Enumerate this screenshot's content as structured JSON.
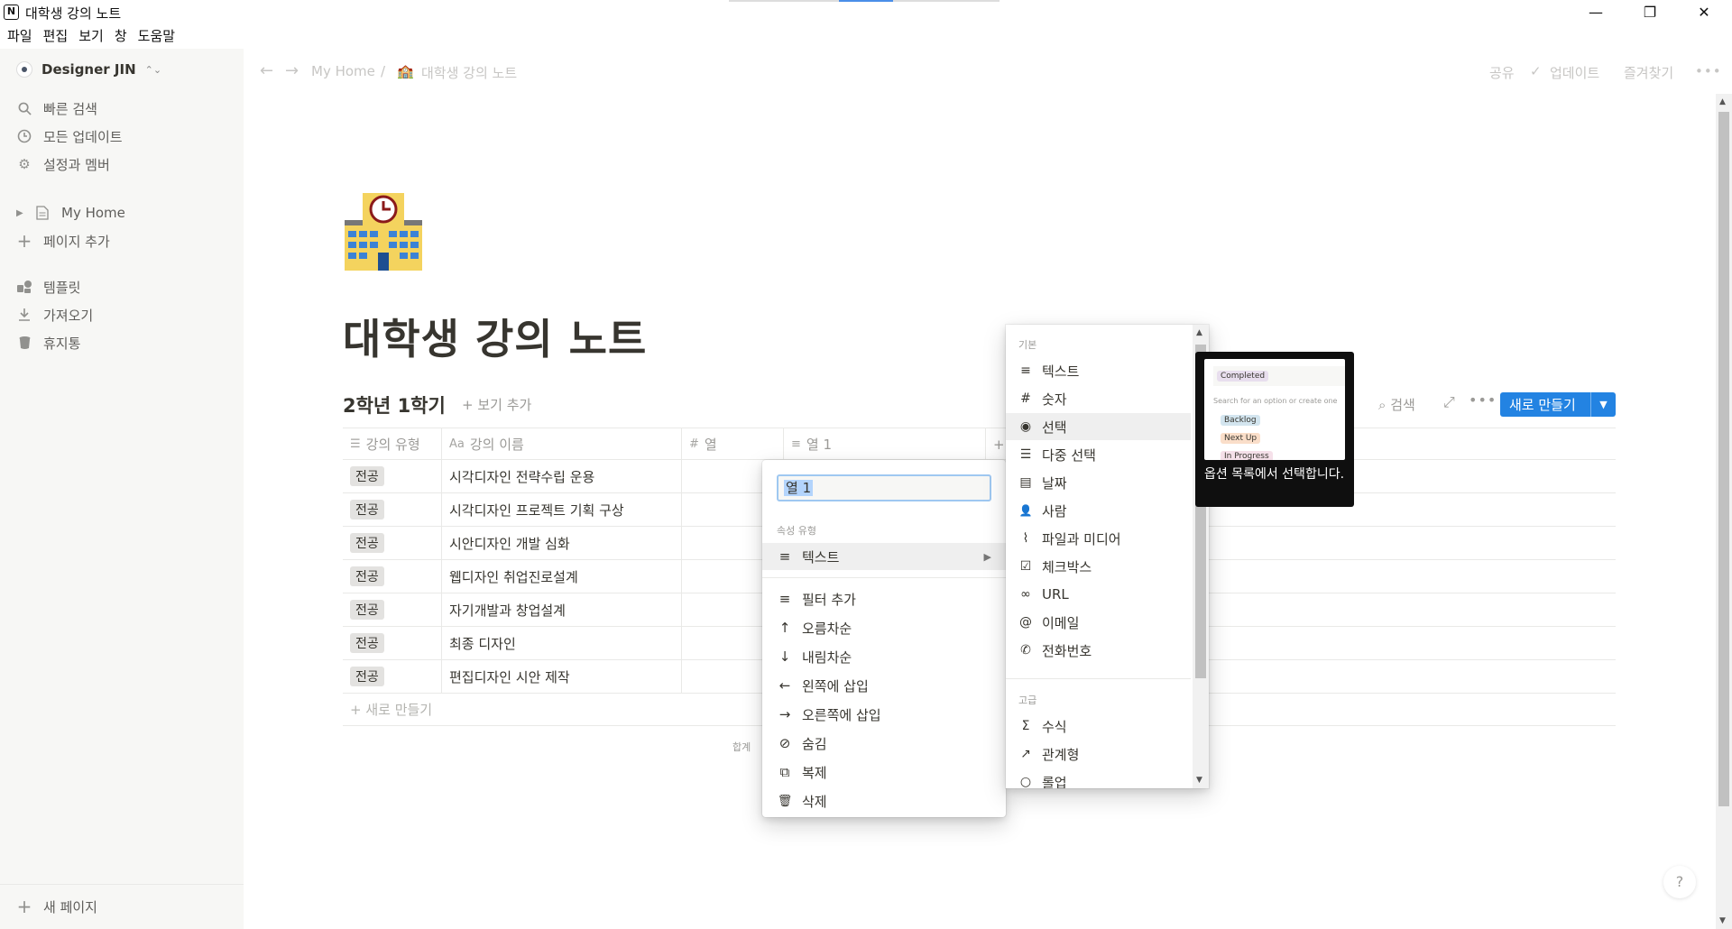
{
  "window": {
    "title": "대학생 강의 노트",
    "logo_letter": "N",
    "minimize": "—",
    "maximize": "❐",
    "close": "✕"
  },
  "menubar": [
    "파일",
    "편집",
    "보기",
    "창",
    "도움말"
  ],
  "sidebar": {
    "workspace": "Designer JIN",
    "items": [
      {
        "label": "빠른 검색",
        "icon": "search-icon"
      },
      {
        "label": "모든 업데이트",
        "icon": "clock-icon"
      },
      {
        "label": "설정과 멤버",
        "icon": "gear-icon"
      }
    ],
    "pages": [
      {
        "label": "My Home",
        "icon": "page-icon"
      },
      {
        "label": "페이지 추가",
        "icon": "plus-icon"
      }
    ],
    "tools": [
      {
        "label": "템플릿",
        "icon": "template-icon"
      },
      {
        "label": "가져오기",
        "icon": "download-icon"
      },
      {
        "label": "휴지통",
        "icon": "trash-icon"
      }
    ],
    "new_page": "새 페이지"
  },
  "topbar": {
    "breadcrumb": [
      "My Home",
      "대학생 강의 노트"
    ],
    "share": "공유",
    "updates": "업데이트",
    "favorite": "즐겨찾기",
    "more": "•••"
  },
  "page": {
    "title": "대학생 강의 노트",
    "view_title": "2학년 1학기",
    "add_view": "+ 보기 추가",
    "search": "검색",
    "more": "•••",
    "new_button": "새로 만들기"
  },
  "table": {
    "headers": [
      {
        "label": "강의 유형",
        "icon": "☰"
      },
      {
        "label": "강의 이름",
        "icon": "Aa"
      },
      {
        "label": "열",
        "icon": "#"
      },
      {
        "label": "열 1",
        "icon": "≡"
      },
      {
        "label": "+",
        "icon": ""
      }
    ],
    "rows": [
      {
        "type": "전공",
        "name": "시각디자인 전략수립 운용"
      },
      {
        "type": "전공",
        "name": "시각디자인 프로젝트 기획 구상"
      },
      {
        "type": "전공",
        "name": "시안디자인 개발 심화"
      },
      {
        "type": "전공",
        "name": "웹디자인 취업진로설계"
      },
      {
        "type": "전공",
        "name": "자기개발과 창업설계"
      },
      {
        "type": "전공",
        "name": "최종 디자인"
      },
      {
        "type": "전공",
        "name": "편집디자인 시안 제작"
      }
    ],
    "new_row": "+ 새로 만들기",
    "count_label": "합계"
  },
  "context_menu": {
    "input_value": "열 1",
    "section_label": "속성 유형",
    "type_item": "텍스트",
    "items": [
      {
        "label": "필터 추가",
        "icon": "filter-icon",
        "glyph": "≡"
      },
      {
        "label": "오름차순",
        "icon": "arrow-up-icon",
        "glyph": "↑"
      },
      {
        "label": "내림차순",
        "icon": "arrow-down-icon",
        "glyph": "↓"
      },
      {
        "label": "왼쪽에 삽입",
        "icon": "arrow-left-icon",
        "glyph": "←"
      },
      {
        "label": "오른쪽에 삽입",
        "icon": "arrow-right-icon",
        "glyph": "→"
      },
      {
        "label": "숨김",
        "icon": "eye-off-icon",
        "glyph": "⊘"
      },
      {
        "label": "복제",
        "icon": "duplicate-icon",
        "glyph": "⧉"
      },
      {
        "label": "삭제",
        "icon": "trash-icon",
        "glyph": "🗑"
      }
    ]
  },
  "type_menu": {
    "basic_label": "기본",
    "advanced_label": "고급",
    "basic": [
      {
        "label": "텍스트",
        "icon": "text-icon",
        "glyph": "≡"
      },
      {
        "label": "숫자",
        "icon": "number-icon",
        "glyph": "#"
      },
      {
        "label": "선택",
        "icon": "select-icon",
        "glyph": "◉"
      },
      {
        "label": "다중 선택",
        "icon": "multi-select-icon",
        "glyph": "☰"
      },
      {
        "label": "날짜",
        "icon": "calendar-icon",
        "glyph": "▤"
      },
      {
        "label": "사람",
        "icon": "person-icon",
        "glyph": "👤"
      },
      {
        "label": "파일과 미디어",
        "icon": "attachment-icon",
        "glyph": "⌇"
      },
      {
        "label": "체크박스",
        "icon": "checkbox-icon",
        "glyph": "☑"
      },
      {
        "label": "URL",
        "icon": "link-icon",
        "glyph": "∞"
      },
      {
        "label": "이메일",
        "icon": "at-icon",
        "glyph": "@"
      },
      {
        "label": "전화번호",
        "icon": "phone-icon",
        "glyph": "✆"
      }
    ],
    "advanced": [
      {
        "label": "수식",
        "icon": "sigma-icon",
        "glyph": "Σ"
      },
      {
        "label": "관계형",
        "icon": "relation-icon",
        "glyph": "↗"
      },
      {
        "label": "롤업",
        "icon": "rollup-icon",
        "glyph": "○"
      }
    ]
  },
  "preview": {
    "tags": [
      "Completed",
      "Backlog",
      "Next Up",
      "In Progress"
    ],
    "hint": "Search for an option or create one",
    "description": "옵션 목록에서 선택합니다."
  },
  "help": "?"
}
